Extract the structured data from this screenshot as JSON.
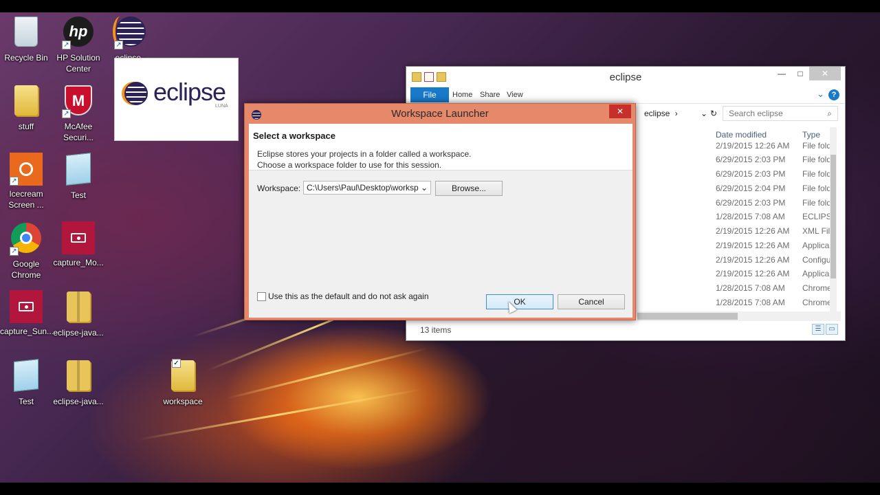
{
  "desktop": {
    "icons": [
      {
        "id": "recycle-bin",
        "label": "Recycle Bin",
        "icon": "recycle-bin-icon"
      },
      {
        "id": "hp-solution-center",
        "label": "HP Solution Center",
        "icon": "hp-icon"
      },
      {
        "id": "eclipse-shortcut",
        "label": "eclipse - Shortcut",
        "icon": "eclipse-icon"
      },
      {
        "id": "stuff",
        "label": "stuff",
        "icon": "folder-icon"
      },
      {
        "id": "mcafee",
        "label": "McAfee Securi...",
        "icon": "mcafee-icon"
      },
      {
        "id": "icecream",
        "label": "Icecream Screen ...",
        "icon": "icecream-icon"
      },
      {
        "id": "test-1",
        "label": "Test",
        "icon": "notepad-icon"
      },
      {
        "id": "chrome",
        "label": "Google Chrome",
        "icon": "chrome-icon"
      },
      {
        "id": "capture-mo",
        "label": "capture_Mo...",
        "icon": "video-icon"
      },
      {
        "id": "capture-sun",
        "label": "capture_Sun...",
        "icon": "video-icon"
      },
      {
        "id": "eclipse-java-1",
        "label": "eclipse-java...",
        "icon": "zip-folder-icon"
      },
      {
        "id": "test-2",
        "label": "Test",
        "icon": "notepad-icon"
      },
      {
        "id": "eclipse-java-2",
        "label": "eclipse-java...",
        "icon": "zip-folder-icon"
      },
      {
        "id": "workspace",
        "label": "workspace",
        "icon": "folder-icon"
      }
    ]
  },
  "splash": {
    "wordmark": "eclipse",
    "edition": "LUNA"
  },
  "explorer": {
    "title": "eclipse",
    "ribbon": {
      "file": "File",
      "tabs": [
        "Home",
        "Share",
        "View"
      ]
    },
    "breadcrumb": "eclipse",
    "search_placeholder": "Search eclipse",
    "columns": {
      "date": "Date modified",
      "type": "Type"
    },
    "rows": [
      {
        "date": "2/19/2015 12:26 AM",
        "type": "File fold"
      },
      {
        "date": "6/29/2015 2:03 PM",
        "type": "File fold"
      },
      {
        "date": "6/29/2015 2:03 PM",
        "type": "File fold"
      },
      {
        "date": "6/29/2015 2:04 PM",
        "type": "File fold"
      },
      {
        "date": "6/29/2015 2:03 PM",
        "type": "File fold"
      },
      {
        "date": "1/28/2015 7:08 AM",
        "type": "ECLIPSE"
      },
      {
        "date": "2/19/2015 12:26 AM",
        "type": "XML File"
      },
      {
        "date": "2/19/2015 12:26 AM",
        "type": "Applica"
      },
      {
        "date": "2/19/2015 12:26 AM",
        "type": "Configu"
      },
      {
        "date": "2/19/2015 12:26 AM",
        "type": "Applica"
      },
      {
        "date": "1/28/2015 7:08 AM",
        "type": "Chrome"
      },
      {
        "date": "1/28/2015 7:08 AM",
        "type": "Chrome"
      }
    ],
    "status": "13 items"
  },
  "dialog": {
    "title": "Workspace Launcher",
    "heading": "Select a workspace",
    "message_line1": "Eclipse stores your projects in a folder called a workspace.",
    "message_line2": "Choose a workspace folder to use for this session.",
    "workspace_label": "Workspace:",
    "workspace_value": "C:\\Users\\Paul\\Desktop\\worksp",
    "browse_label": "Browse...",
    "default_checkbox_label": "Use this as the default and do not ask again",
    "default_checked": false,
    "ok_label": "OK",
    "cancel_label": "Cancel"
  }
}
